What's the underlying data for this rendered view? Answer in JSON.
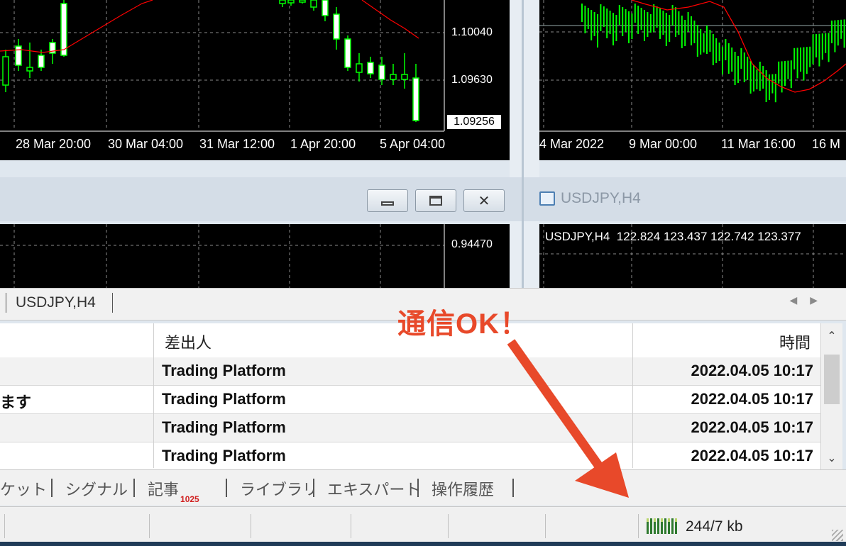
{
  "colors": {
    "accent": "#e8492a",
    "chart_bg": "#000000",
    "candle": "#00ff00",
    "ma_line": "#ff0000"
  },
  "chart_top_left": {
    "price_ticks": [
      "1.10040",
      "1.09630"
    ],
    "current_price": "1.09256",
    "time_ticks": [
      "28 Mar 20:00",
      "30 Mar 04:00",
      "31 Mar 12:00",
      "1 Apr 20:00",
      "5 Apr 04:00"
    ]
  },
  "chart_top_right": {
    "time_ticks": [
      "4 Mar 2022",
      "9 Mar 00:00",
      "11 Mar 16:00",
      "16 M"
    ]
  },
  "chart_mid_left": {
    "price_ticks": [
      "0.94470"
    ]
  },
  "chart_mid_right": {
    "window_title": "USDJPY,H4",
    "info_line": "USDJPY,H4  122.824 123.437 122.742 123.377"
  },
  "window_controls": {
    "minimize_icon": "minimize-icon",
    "restore_icon": "restore-icon",
    "close_icon": "close-icon"
  },
  "terminal": {
    "chart_tab": "USDJPY,H4",
    "columns": {
      "sender": "差出人",
      "time": "時間"
    },
    "rows": [
      {
        "subject": "",
        "sender": "Trading Platform",
        "time": "2022.04.05 10:17"
      },
      {
        "subject": "ます",
        "sender": "Trading Platform",
        "time": "2022.04.05 10:17"
      },
      {
        "subject": "",
        "sender": "Trading Platform",
        "time": "2022.04.05 10:17"
      },
      {
        "subject": "",
        "sender": "Trading Platform",
        "time": "2022.04.05 10:17"
      }
    ],
    "bottom_tabs": [
      {
        "label": "ケット"
      },
      {
        "label": "シグナル"
      },
      {
        "label": "記事",
        "badge": "1025"
      },
      {
        "label": "ライブラリ"
      },
      {
        "label": "エキスパート"
      },
      {
        "label": "操作履歴"
      }
    ]
  },
  "status": {
    "traffic": "244/7 kb"
  },
  "annotation": {
    "callout": "通信OK！"
  }
}
